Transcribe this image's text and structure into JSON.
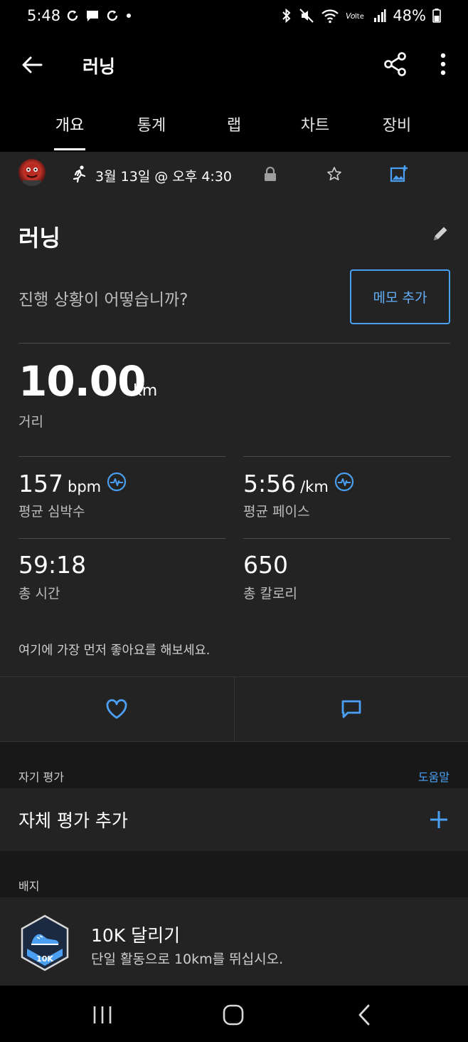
{
  "status_bar": {
    "time": "5:48",
    "battery": "48%",
    "left_icons": [
      "sync-icon",
      "chat-icon",
      "sync-icon",
      "dot-icon"
    ],
    "right_icons": [
      "bluetooth-icon",
      "mute-icon",
      "wifi-icon",
      "volte-icon",
      "signal-icon",
      "battery-icon"
    ]
  },
  "app_bar": {
    "title": "러닝"
  },
  "tabs": [
    {
      "label": "개요",
      "active": true
    },
    {
      "label": "통계"
    },
    {
      "label": "랩"
    },
    {
      "label": "차트"
    },
    {
      "label": "장비"
    }
  ],
  "activity": {
    "date": "3월 13일 @ 오후 4:30",
    "title": "러닝",
    "prompt": "진행 상황이 어떻습니까?",
    "memo_button": "메모 추가",
    "distance": {
      "value": "10.00",
      "unit": "km",
      "label": "거리"
    },
    "stats": [
      {
        "value": "157",
        "unit": "bpm",
        "label": "평균 심박수",
        "has_icon": true
      },
      {
        "value": "5:56",
        "unit": "/km",
        "label": "평균 페이스",
        "has_icon": true
      },
      {
        "value": "59:18",
        "unit": "",
        "label": "총 시간"
      },
      {
        "value": "650",
        "unit": "",
        "label": "총 칼로리"
      }
    ],
    "likes_text": "여기에 가장 먼저 좋아요를 해보세요."
  },
  "self_evaluation": {
    "section_label": "자기 평가",
    "help_link": "도움말",
    "add_label": "자체 평가 추가"
  },
  "badges": {
    "section_label": "배지",
    "items": [
      {
        "title": "10K 달리기",
        "description": "단일 활동으로 10km를 뛰십시오.",
        "icon_text": "10K"
      }
    ]
  },
  "colors": {
    "accent": "#4a9ff2",
    "background": "#232323"
  }
}
